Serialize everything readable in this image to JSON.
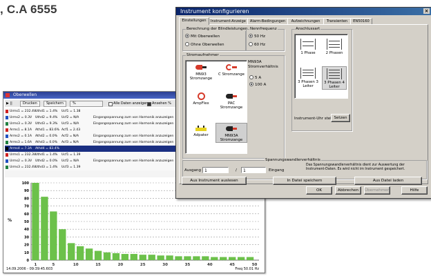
{
  "heading": ", C.A 6555",
  "back_window": {
    "title": "Oberwellen",
    "toolbar": {
      "print": "Drucken",
      "save": "Speichern",
      "unit": "%",
      "show_all": "Alle Daten anzeigen",
      "show_s": "Ansehen %"
    },
    "rows": [
      {
        "c1": "Urms1 = 232.4V",
        "c2": "Uthd1 = 1.4%",
        "c3": "Ucf1 = 1.38",
        "note": "",
        "color": "#d02020",
        "selected": false
      },
      {
        "c1": "Urms2 = 0.3V",
        "c2": "Uthd2 = 9.4%",
        "c3": "Ucf2 = N/A",
        "note": "Eingangsspannung zum von Harmonik anzuzeigen",
        "color": "#2050c0",
        "selected": false
      },
      {
        "c1": "Urms3 = 0.3V",
        "c2": "Uthd3 = 9.3%",
        "c3": "Ucf3 = N/A",
        "note": "Eingangsspannung zum von Harmonik anzuzeigen",
        "color": "#208040",
        "selected": false
      },
      {
        "c1": "Arms1 = 8.1A",
        "c2": "Athd1 = 83.6%",
        "c3": "Acf1 = 2.43",
        "note": "",
        "color": "#d02020",
        "selected": false
      },
      {
        "c1": "Arms2 = 0.1A",
        "c2": "Athd2 = 0.0%",
        "c3": "Acf2 = N/A",
        "note": "Eingangsspannung zum von Harmonik anzuzeigen",
        "color": "#2050c0",
        "selected": false
      },
      {
        "c1": "Arms3 = 1.6A",
        "c2": "Athd3 = 0.0%",
        "c3": "Acf3 = N/A",
        "note": "Eingangsspannung zum von Harmonik anzuzeigen",
        "color": "#208040",
        "selected": false
      },
      {
        "c1": "Arms4 = 7.3A",
        "c2": "Athd4 = 83.4%",
        "c3": "",
        "note": "",
        "color": "#000000",
        "selected": true
      },
      {
        "c1": "Urms1 = 232.3V",
        "c2": "Uthd1 = 1.4%",
        "c3": "Ucf1 = 1.39",
        "note": "",
        "color": "#d02020",
        "selected": false
      },
      {
        "c1": "Urms2 = 0.3V",
        "c2": "Uthd2 = 0.0%",
        "c3": "Ucf2 = N/A",
        "note": "Eingangsspannung zum von Harmonik anzuzeigen",
        "color": "#2050c0",
        "selected": false
      },
      {
        "c1": "Urms3 = 232.4V",
        "c2": "Uthd3 = 1.4%",
        "c3": "Ucf3 = 1.39",
        "note": "",
        "color": "#208040",
        "selected": false
      }
    ],
    "status_left": "14.09.2006 - 09:39:45.603",
    "status_right": "Freq 50.01 Hz"
  },
  "chart_data": {
    "type": "bar",
    "x": [
      1,
      3,
      5,
      7,
      9,
      11,
      13,
      15,
      17,
      19,
      21,
      23,
      25,
      27,
      29,
      31,
      33,
      35,
      37,
      39,
      41,
      43,
      45,
      47,
      49
    ],
    "values": [
      100,
      82,
      63,
      40,
      22,
      18,
      15,
      12,
      10,
      9,
      8,
      8,
      7,
      7,
      6,
      6,
      5,
      5,
      5,
      5,
      4,
      4,
      4,
      4,
      4
    ],
    "ylim": [
      0,
      100
    ],
    "xlim": [
      0,
      51
    ],
    "y_ticks": [
      0,
      10,
      20,
      30,
      40,
      50,
      60,
      70,
      80,
      90,
      100
    ],
    "x_ticks": [
      1,
      5,
      10,
      15,
      20,
      25,
      30,
      35,
      40,
      45,
      50
    ],
    "ylabel": "%",
    "bar_color": "#6cc14a",
    "grid": true
  },
  "front_window": {
    "title": "Instrument konfigurieren",
    "close_glyph": "×",
    "tabs": [
      "Einstellungen",
      "Instrument-Anzeige",
      "Alarm-Bedingungen",
      "Aufzeichnungen",
      "Transienten",
      "EN50160"
    ],
    "active_tab": 0,
    "calc": {
      "label": "Berechnung der Blindleistungen",
      "with": "Mit Oberwellen",
      "without": "Ohne Oberwellen"
    },
    "freq": {
      "label": "Nennfrequenz",
      "f50": "50 Hz",
      "f60": "60 Hz"
    },
    "sensors_label": "Stromaufnehmer",
    "sensors": [
      "MN93 Stromzange",
      "C Stromzange",
      "AmpFlex",
      "PAC Stromzange",
      "Adpater",
      "MN93A Stromzange"
    ],
    "selected_sensor": 5,
    "ratio": {
      "label": "MN93A Stromverhältnis",
      "o5": "5 A",
      "o100": "100 A"
    },
    "connect": {
      "label": "Anschlussart",
      "items": [
        "1 Phase",
        "2 Phasen",
        "3 Phasen 3 Leiter",
        "3 Phasen 4 Leiter"
      ],
      "selected": 3
    },
    "clock": {
      "label": "Instrument-Uhr stellen",
      "button": "Setzen"
    },
    "voltage_ratio": {
      "label": "Spannungswandlerverhältnis",
      "output_label": "Ausgang",
      "output_value": "1",
      "slash": "/",
      "input_value": "1",
      "input_label": "Eingang",
      "desc": "Das Spannungswandlerverhältnis dient zur Auswertung der Instrument-Daten. Es wird nicht im Instrument gespeichert."
    },
    "buttons": {
      "read": "Aus Instrument auslesen",
      "save": "In Datei speichern",
      "load": "Aus Datei laden",
      "ok": "OK",
      "cancel": "Abbrechen",
      "apply": "Übernehmen",
      "help": "Hilfe"
    }
  }
}
